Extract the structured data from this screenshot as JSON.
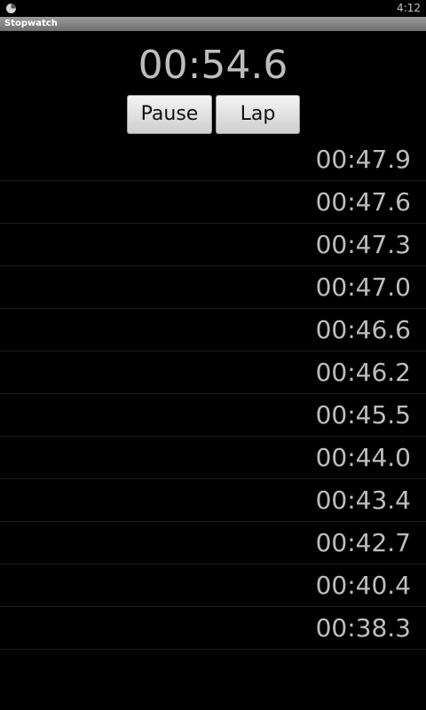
{
  "status_bar": {
    "icon": "stopwatch-icon",
    "clock": "4:12"
  },
  "title_bar": {
    "title": "Stopwatch"
  },
  "timer": {
    "display": "00:54.6"
  },
  "controls": {
    "pause_label": "Pause",
    "lap_label": "Lap"
  },
  "laps": [
    "00:47.9",
    "00:47.6",
    "00:47.3",
    "00:47.0",
    "00:46.6",
    "00:46.2",
    "00:45.5",
    "00:44.0",
    "00:43.4",
    "00:42.7",
    "00:40.4",
    "00:38.3"
  ]
}
